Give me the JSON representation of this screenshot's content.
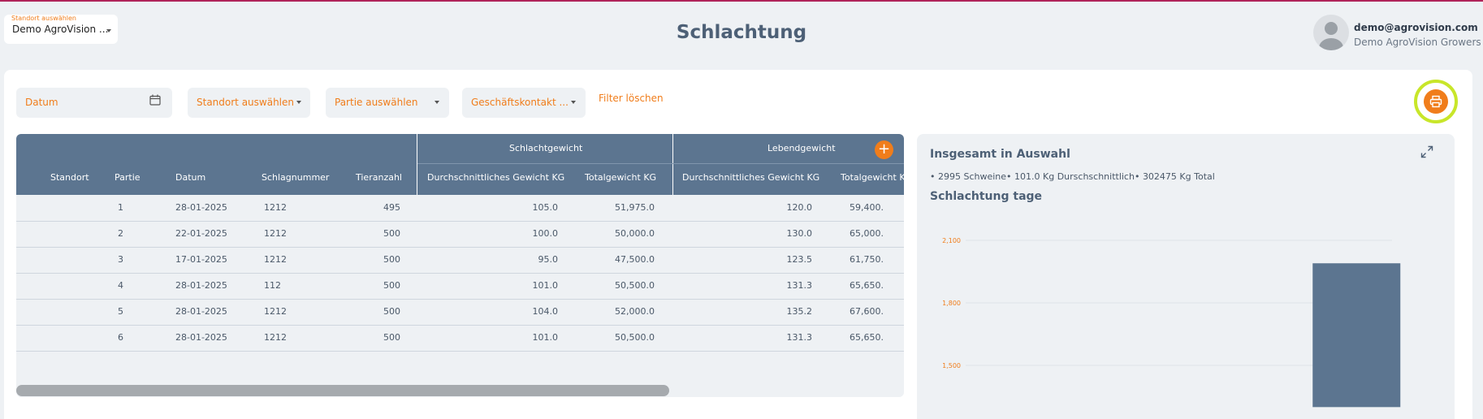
{
  "header": {
    "site_select": {
      "label": "Standort auswählen",
      "value": "Demo AgroVision ..."
    },
    "title": "Schlachtung",
    "user": {
      "email": "demo@agrovision.com",
      "org": "Demo AgroVision Growers"
    }
  },
  "filters": {
    "date_placeholder": "Datum",
    "site": "Standort auswählen",
    "batch": "Partie auswählen",
    "contact": "Geschäftskontakt ...",
    "clear": "Filter löschen"
  },
  "table": {
    "groups": {
      "slaughter": "Schlachtgewicht",
      "live": "Lebendgewicht"
    },
    "columns": {
      "standort": "Standort",
      "partie": "Partie",
      "datum": "Datum",
      "schlagnummer": "Schlagnummer",
      "tieranzahl": "Tieranzahl",
      "sg_avg": "Durchschnittliches Gewicht KG",
      "sg_total": "Totalgewicht KG",
      "lg_avg": "Durchschnittliches Gewicht KG",
      "lg_total": "Totalgewicht KG"
    },
    "rows": [
      {
        "partie": "1",
        "datum": "28-01-2025",
        "schlag": "1212",
        "anzahl": "495",
        "sg_avg": "105.0",
        "sg_total": "51,975.0",
        "lg_avg": "120.0",
        "lg_total": "59,400."
      },
      {
        "partie": "2",
        "datum": "22-01-2025",
        "schlag": "1212",
        "anzahl": "500",
        "sg_avg": "100.0",
        "sg_total": "50,000.0",
        "lg_avg": "130.0",
        "lg_total": "65,000."
      },
      {
        "partie": "3",
        "datum": "17-01-2025",
        "schlag": "1212",
        "anzahl": "500",
        "sg_avg": "95.0",
        "sg_total": "47,500.0",
        "lg_avg": "123.5",
        "lg_total": "61,750."
      },
      {
        "partie": "4",
        "datum": "28-01-2025",
        "schlag": "112",
        "anzahl": "500",
        "sg_avg": "101.0",
        "sg_total": "50,500.0",
        "lg_avg": "131.3",
        "lg_total": "65,650."
      },
      {
        "partie": "5",
        "datum": "28-01-2025",
        "schlag": "1212",
        "anzahl": "500",
        "sg_avg": "104.0",
        "sg_total": "52,000.0",
        "lg_avg": "135.2",
        "lg_total": "67,600."
      },
      {
        "partie": "6",
        "datum": "28-01-2025",
        "schlag": "1212",
        "anzahl": "500",
        "sg_avg": "101.0",
        "sg_total": "50,500.0",
        "lg_avg": "131.3",
        "lg_total": "65,650."
      }
    ]
  },
  "summary": {
    "title": "Insgesamt in Auswahl",
    "text": "• 2995 Schweine• 101.0 Kg Durschschnittlich• 302475 Kg Total",
    "chart_title": "Schlachtung tage"
  },
  "chart_data": {
    "type": "bar",
    "title": "Schlachtung tage",
    "ylim": [
      1300,
      2150
    ],
    "yticks": [
      1500,
      1800,
      2100
    ],
    "ytick_labels": [
      "1,500",
      "1,800",
      "2,100"
    ],
    "categories": [
      "",
      "",
      "",
      "",
      "",
      ""
    ],
    "values": [
      null,
      null,
      null,
      null,
      null,
      1990
    ],
    "grid": true,
    "bar_color": "#5c7590",
    "tick_color": "#f07d1b"
  },
  "colors": {
    "accent": "#f07d1b",
    "header": "#5c7590",
    "highlight": "#c8e62a"
  },
  "icons": {
    "calendar": "calendar-icon",
    "print": "printer-icon",
    "expand": "expand-icon",
    "add": "plus-icon"
  }
}
